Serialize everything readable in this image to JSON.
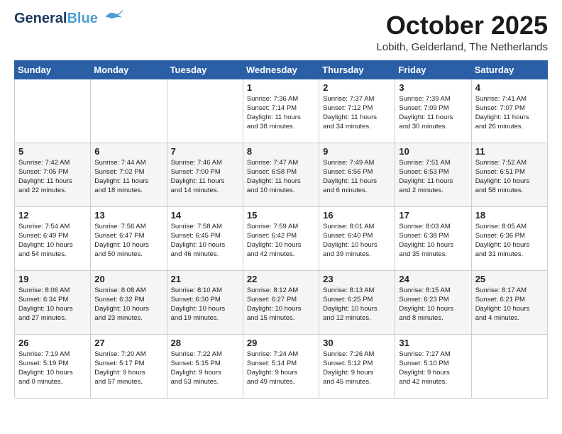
{
  "header": {
    "logo_line1": "General",
    "logo_line2": "Blue",
    "month": "October 2025",
    "location": "Lobith, Gelderland, The Netherlands"
  },
  "days_of_week": [
    "Sunday",
    "Monday",
    "Tuesday",
    "Wednesday",
    "Thursday",
    "Friday",
    "Saturday"
  ],
  "weeks": [
    [
      {
        "day": "",
        "content": ""
      },
      {
        "day": "",
        "content": ""
      },
      {
        "day": "",
        "content": ""
      },
      {
        "day": "1",
        "content": "Sunrise: 7:36 AM\nSunset: 7:14 PM\nDaylight: 11 hours\nand 38 minutes."
      },
      {
        "day": "2",
        "content": "Sunrise: 7:37 AM\nSunset: 7:12 PM\nDaylight: 11 hours\nand 34 minutes."
      },
      {
        "day": "3",
        "content": "Sunrise: 7:39 AM\nSunset: 7:09 PM\nDaylight: 11 hours\nand 30 minutes."
      },
      {
        "day": "4",
        "content": "Sunrise: 7:41 AM\nSunset: 7:07 PM\nDaylight: 11 hours\nand 26 minutes."
      }
    ],
    [
      {
        "day": "5",
        "content": "Sunrise: 7:42 AM\nSunset: 7:05 PM\nDaylight: 11 hours\nand 22 minutes."
      },
      {
        "day": "6",
        "content": "Sunrise: 7:44 AM\nSunset: 7:02 PM\nDaylight: 11 hours\nand 18 minutes."
      },
      {
        "day": "7",
        "content": "Sunrise: 7:46 AM\nSunset: 7:00 PM\nDaylight: 11 hours\nand 14 minutes."
      },
      {
        "day": "8",
        "content": "Sunrise: 7:47 AM\nSunset: 6:58 PM\nDaylight: 11 hours\nand 10 minutes."
      },
      {
        "day": "9",
        "content": "Sunrise: 7:49 AM\nSunset: 6:56 PM\nDaylight: 11 hours\nand 6 minutes."
      },
      {
        "day": "10",
        "content": "Sunrise: 7:51 AM\nSunset: 6:53 PM\nDaylight: 11 hours\nand 2 minutes."
      },
      {
        "day": "11",
        "content": "Sunrise: 7:52 AM\nSunset: 6:51 PM\nDaylight: 10 hours\nand 58 minutes."
      }
    ],
    [
      {
        "day": "12",
        "content": "Sunrise: 7:54 AM\nSunset: 6:49 PM\nDaylight: 10 hours\nand 54 minutes."
      },
      {
        "day": "13",
        "content": "Sunrise: 7:56 AM\nSunset: 6:47 PM\nDaylight: 10 hours\nand 50 minutes."
      },
      {
        "day": "14",
        "content": "Sunrise: 7:58 AM\nSunset: 6:45 PM\nDaylight: 10 hours\nand 46 minutes."
      },
      {
        "day": "15",
        "content": "Sunrise: 7:59 AM\nSunset: 6:42 PM\nDaylight: 10 hours\nand 42 minutes."
      },
      {
        "day": "16",
        "content": "Sunrise: 8:01 AM\nSunset: 6:40 PM\nDaylight: 10 hours\nand 39 minutes."
      },
      {
        "day": "17",
        "content": "Sunrise: 8:03 AM\nSunset: 6:38 PM\nDaylight: 10 hours\nand 35 minutes."
      },
      {
        "day": "18",
        "content": "Sunrise: 8:05 AM\nSunset: 6:36 PM\nDaylight: 10 hours\nand 31 minutes."
      }
    ],
    [
      {
        "day": "19",
        "content": "Sunrise: 8:06 AM\nSunset: 6:34 PM\nDaylight: 10 hours\nand 27 minutes."
      },
      {
        "day": "20",
        "content": "Sunrise: 8:08 AM\nSunset: 6:32 PM\nDaylight: 10 hours\nand 23 minutes."
      },
      {
        "day": "21",
        "content": "Sunrise: 8:10 AM\nSunset: 6:30 PM\nDaylight: 10 hours\nand 19 minutes."
      },
      {
        "day": "22",
        "content": "Sunrise: 8:12 AM\nSunset: 6:27 PM\nDaylight: 10 hours\nand 15 minutes."
      },
      {
        "day": "23",
        "content": "Sunrise: 8:13 AM\nSunset: 6:25 PM\nDaylight: 10 hours\nand 12 minutes."
      },
      {
        "day": "24",
        "content": "Sunrise: 8:15 AM\nSunset: 6:23 PM\nDaylight: 10 hours\nand 8 minutes."
      },
      {
        "day": "25",
        "content": "Sunrise: 8:17 AM\nSunset: 6:21 PM\nDaylight: 10 hours\nand 4 minutes."
      }
    ],
    [
      {
        "day": "26",
        "content": "Sunrise: 7:19 AM\nSunset: 5:19 PM\nDaylight: 10 hours\nand 0 minutes."
      },
      {
        "day": "27",
        "content": "Sunrise: 7:20 AM\nSunset: 5:17 PM\nDaylight: 9 hours\nand 57 minutes."
      },
      {
        "day": "28",
        "content": "Sunrise: 7:22 AM\nSunset: 5:15 PM\nDaylight: 9 hours\nand 53 minutes."
      },
      {
        "day": "29",
        "content": "Sunrise: 7:24 AM\nSunset: 5:14 PM\nDaylight: 9 hours\nand 49 minutes."
      },
      {
        "day": "30",
        "content": "Sunrise: 7:26 AM\nSunset: 5:12 PM\nDaylight: 9 hours\nand 45 minutes."
      },
      {
        "day": "31",
        "content": "Sunrise: 7:27 AM\nSunset: 5:10 PM\nDaylight: 9 hours\nand 42 minutes."
      },
      {
        "day": "",
        "content": ""
      }
    ]
  ]
}
